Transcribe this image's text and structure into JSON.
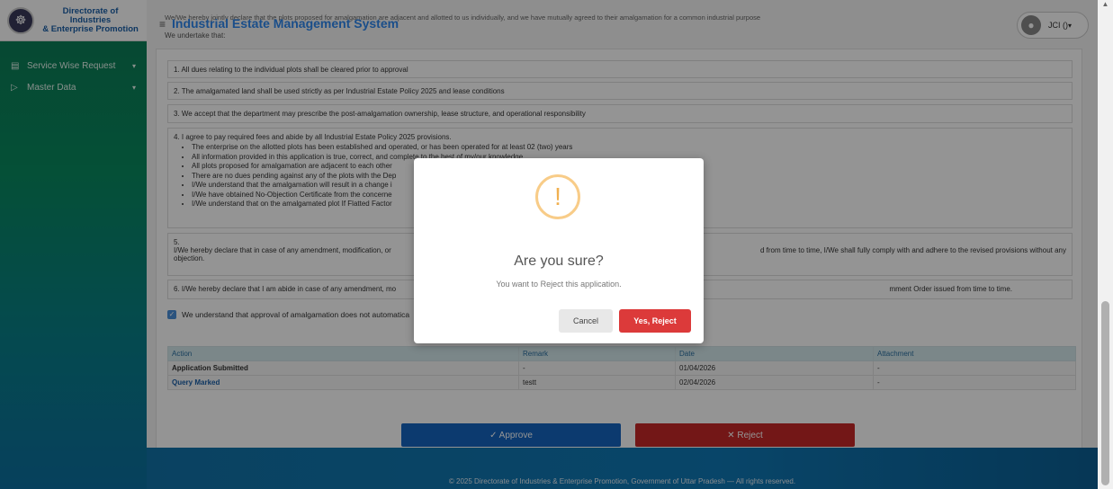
{
  "brand": {
    "line1": "Directorate of Industries",
    "line2": "& Enterprise Promotion"
  },
  "sidebar": {
    "items": [
      {
        "label": "Service Wise Request"
      },
      {
        "label": "Master Data"
      }
    ]
  },
  "header": {
    "title": "Industrial Estate Management System",
    "declaration": "We/We hereby jointly declare that the plots proposed for amalgamation are adjacent and allotted to us individually, and we have mutually agreed to their amalgamation for a common industrial purpose",
    "undertake": "We undertake that:",
    "user": "JCI () "
  },
  "items": {
    "i1": "1. All dues relating to the individual plots shall be cleared prior to approval",
    "i2": "2. The amalgamated land shall be used strictly as per Industrial Estate Policy 2025 and lease conditions",
    "i3": "3. We accept that the department may prescribe the post-amalgamation ownership, lease structure, and operational responsibility",
    "i4": "4. I agree to pay required fees and abide by all Industrial Estate Policy 2025 provisions.",
    "i4_bullets": [
      "The enterprise on the allotted plots has been established and operated, or has been operated for at least 02 (two) years",
      "All information provided in this application is true, correct, and complete to the best of my/our knowledge",
      "All plots proposed for amalgamation are adjacent to each other",
      "There are no dues pending against any of the plots with the Dep",
      "I/We understand that the amalgamation will result in a change i",
      "I/We have obtained No-Objection Certificate from the concerne",
      "I/We understand that on the amalgamated plot If Flatted Factor"
    ],
    "i5_num": "5.",
    "i5_left": "I/We hereby declare that in case of any amendment, modification, or",
    "i5_right": "d from time to time, I/We shall fully comply with and adhere to the revised provisions without any",
    "i5_tail": "objection.",
    "i6_left": "6. I/We hereby declare that I am abide in case of any amendment, mo",
    "i6_right": "mment Order issued from time to time.",
    "check": "We understand that approval of amalgamation does not automatica"
  },
  "table": {
    "headers": [
      "Action",
      "Remark",
      "Date",
      "Attachment"
    ],
    "rows": [
      {
        "action": "Application Submitted",
        "remark": "-",
        "date": "01/04/2026",
        "attachment": "-"
      },
      {
        "action": "Query Marked",
        "remark": "testt",
        "date": "02/04/2026",
        "attachment": "-"
      }
    ]
  },
  "actions": {
    "approve": "✓ Approve",
    "reject": "✕ Reject"
  },
  "footer": "© 2025 Directorate of Industries & Enterprise Promotion, Government of Uttar Pradesh — All rights reserved.",
  "modal": {
    "title": "Are you sure?",
    "text": "You want to Reject this application.",
    "cancel": "Cancel",
    "confirm": "Yes, Reject"
  }
}
